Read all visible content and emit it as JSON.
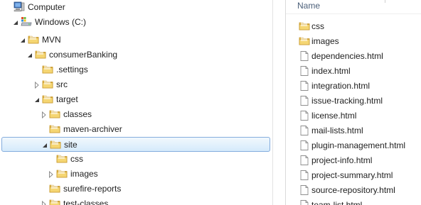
{
  "tree": {
    "items": [
      {
        "label": "Computer",
        "icon": "computer-icon",
        "arrow": "none"
      },
      {
        "label": "Windows (C:)",
        "icon": "drive-icon",
        "arrow": "expanded"
      },
      {
        "label": "MVN",
        "icon": "folder-icon",
        "arrow": "expanded"
      },
      {
        "label": "consumerBanking",
        "icon": "folder-icon",
        "arrow": "expanded"
      },
      {
        "label": ".settings",
        "icon": "folder-icon",
        "arrow": "none"
      },
      {
        "label": "src",
        "icon": "folder-icon",
        "arrow": "collapsed"
      },
      {
        "label": "target",
        "icon": "folder-icon",
        "arrow": "expanded"
      },
      {
        "label": "classes",
        "icon": "folder-icon",
        "arrow": "collapsed"
      },
      {
        "label": "maven-archiver",
        "icon": "folder-icon",
        "arrow": "none"
      },
      {
        "label": "site",
        "icon": "folder-icon",
        "arrow": "expanded",
        "selected": true
      },
      {
        "label": "css",
        "icon": "folder-icon",
        "arrow": "none"
      },
      {
        "label": "images",
        "icon": "folder-icon",
        "arrow": "collapsed"
      },
      {
        "label": "surefire-reports",
        "icon": "folder-icon",
        "arrow": "none"
      },
      {
        "label": "test-classes",
        "icon": "folder-icon",
        "arrow": "collapsed"
      }
    ]
  },
  "list": {
    "column_header": "Name",
    "items": [
      {
        "label": "css",
        "icon": "folder-icon"
      },
      {
        "label": "images",
        "icon": "folder-icon"
      },
      {
        "label": "dependencies.html",
        "icon": "file-icon"
      },
      {
        "label": "index.html",
        "icon": "file-icon"
      },
      {
        "label": "integration.html",
        "icon": "file-icon"
      },
      {
        "label": "issue-tracking.html",
        "icon": "file-icon"
      },
      {
        "label": "license.html",
        "icon": "file-icon"
      },
      {
        "label": "mail-lists.html",
        "icon": "file-icon"
      },
      {
        "label": "plugin-management.html",
        "icon": "file-icon"
      },
      {
        "label": "project-info.html",
        "icon": "file-icon"
      },
      {
        "label": "project-summary.html",
        "icon": "file-icon"
      },
      {
        "label": "source-repository.html",
        "icon": "file-icon"
      },
      {
        "label": "team-list.html",
        "icon": "file-icon"
      }
    ]
  },
  "colors": {
    "selection_fill": "#d5eafb",
    "selection_border": "#84acdd",
    "header_text": "#4c607a",
    "folder": "#e8c054"
  }
}
